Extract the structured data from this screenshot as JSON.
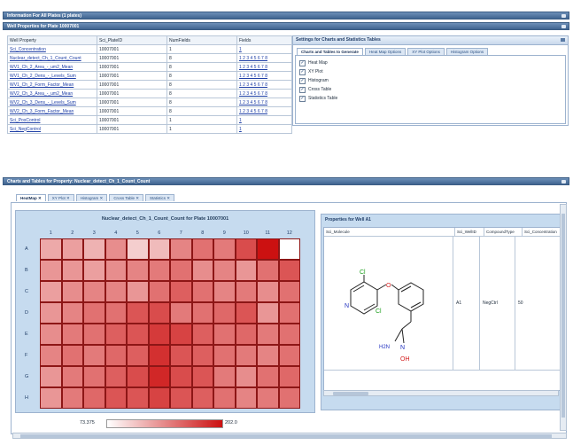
{
  "bars": {
    "all_plates": "Information For All Plates (1 plates)",
    "well_props": "Well Properties for Plate 10007001",
    "charts_tables": "Charts and Tables for Property: Nuclear_detect_Ch_1_Count_Count"
  },
  "well_table": {
    "headers": [
      "Well Property",
      "Sci_PlateID",
      "NumFields",
      "Fields"
    ],
    "rows": [
      {
        "prop": "Sci_Concentration",
        "plate": "10007001",
        "num": "1",
        "fields": "1"
      },
      {
        "prop": "Nuclear_detect_Ch_1_Count_Count",
        "plate": "10007001",
        "num": "8",
        "fields": "1 2 3 4 5 6 7 8"
      },
      {
        "prop": "WV1_Ch_2_Area_-_um2_Mean",
        "plate": "10007001",
        "num": "8",
        "fields": "1 2 3 4 5 6 7 8"
      },
      {
        "prop": "WV1_Ch_2_Dens_-_Levels_Sum",
        "plate": "10007001",
        "num": "8",
        "fields": "1 2 3 4 5 6 7 8"
      },
      {
        "prop": "WV1_Ch_2_Form_Factor_Mean",
        "plate": "10007001",
        "num": "8",
        "fields": "1 2 3 4 5 6 7 8"
      },
      {
        "prop": "WV2_Ch_3_Area_-_um2_Mean",
        "plate": "10007001",
        "num": "8",
        "fields": "1 2 3 4 5 6 7 8"
      },
      {
        "prop": "WV2_Ch_3_Dens_-_Levels_Sum",
        "plate": "10007001",
        "num": "8",
        "fields": "1 2 3 4 5 6 7 8"
      },
      {
        "prop": "WV2_Ch_3_Form_Factor_Mean",
        "plate": "10007001",
        "num": "8",
        "fields": "1 2 3 4 5 6 7 8"
      },
      {
        "prop": "Sci_PosControl",
        "plate": "10007001",
        "num": "1",
        "fields": "1"
      },
      {
        "prop": "Sci_NegControl",
        "plate": "10007001",
        "num": "1",
        "fields": "1"
      }
    ]
  },
  "settings": {
    "title": "Settings for Charts and Statistics Tables",
    "tabs": [
      "Charts and Tables to Generate",
      "Heat Map Options",
      "XY Plot Options",
      "Histogram Options"
    ],
    "checks": [
      {
        "label": "Heat Map",
        "checked": true
      },
      {
        "label": "XY Plot",
        "checked": true
      },
      {
        "label": "Histogram",
        "checked": true
      },
      {
        "label": "Cross Table",
        "checked": true
      },
      {
        "label": "Statistics Table",
        "checked": true
      }
    ]
  },
  "chart_tabs": [
    "HeatMap",
    "XY Plot",
    "Histogram",
    "Cross Table",
    "Statistics"
  ],
  "heatmap": {
    "title": "Nuclear_detect_Ch_1_Count_Count for Plate 10007001",
    "cols": [
      "1",
      "2",
      "3",
      "4",
      "5",
      "6",
      "7",
      "8",
      "9",
      "10",
      "11",
      "12"
    ],
    "rows": [
      "A",
      "B",
      "C",
      "D",
      "E",
      "F",
      "G",
      "H"
    ],
    "min_label": "73.375",
    "max_label": "202.0"
  },
  "chart_data": {
    "type": "heatmap",
    "title": "Nuclear_detect_Ch_1_Count_Count for Plate 10007001",
    "x": [
      "1",
      "2",
      "3",
      "4",
      "5",
      "6",
      "7",
      "8",
      "9",
      "10",
      "11",
      "12"
    ],
    "y": [
      "A",
      "B",
      "C",
      "D",
      "E",
      "F",
      "G",
      "H"
    ],
    "range": [
      73.375,
      202.0
    ],
    "values": [
      [
        120,
        125,
        115,
        135,
        100,
        110,
        140,
        150,
        145,
        170,
        202,
        73.375
      ],
      [
        130,
        130,
        125,
        135,
        140,
        145,
        150,
        135,
        140,
        130,
        150,
        165
      ],
      [
        125,
        135,
        140,
        140,
        130,
        150,
        160,
        150,
        140,
        145,
        135,
        150
      ],
      [
        130,
        140,
        150,
        150,
        165,
        170,
        145,
        150,
        155,
        165,
        130,
        150
      ],
      [
        135,
        145,
        150,
        160,
        165,
        180,
        175,
        160,
        150,
        155,
        145,
        150
      ],
      [
        140,
        150,
        145,
        155,
        160,
        185,
        165,
        160,
        150,
        145,
        140,
        150
      ],
      [
        130,
        145,
        150,
        160,
        170,
        190,
        170,
        165,
        145,
        135,
        150,
        155
      ],
      [
        130,
        145,
        155,
        165,
        165,
        175,
        165,
        160,
        150,
        140,
        145,
        150
      ]
    ]
  },
  "props_panel": {
    "title": "Properties for Well A1",
    "headers": [
      "Sci_Molecule",
      "Sci_WellID",
      "CompoundType",
      "Sci_Concentration"
    ],
    "row": {
      "well": "A1",
      "type": "NegCtrl",
      "conc": "50"
    },
    "atoms": {
      "cl1": "Cl",
      "o": "O",
      "n": "N",
      "cl2": "Cl",
      "nh2": "H2N",
      "n2": "N",
      "oh": "OH"
    }
  }
}
